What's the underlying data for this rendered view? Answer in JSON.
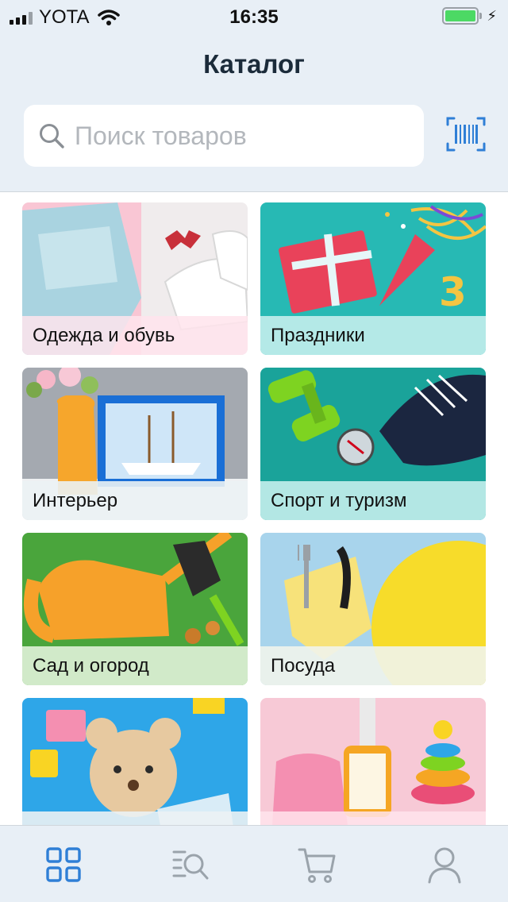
{
  "status_bar": {
    "carrier": "YOTA",
    "time": "16:35"
  },
  "header": {
    "title": "Каталог"
  },
  "search": {
    "placeholder": "Поиск товаров"
  },
  "categories": [
    {
      "label": "Одежда и обувь"
    },
    {
      "label": "Праздники"
    },
    {
      "label": "Интерьер"
    },
    {
      "label": "Спорт и туризм"
    },
    {
      "label": "Сад и огород"
    },
    {
      "label": "Посуда"
    },
    {
      "label": ""
    },
    {
      "label": ""
    }
  ],
  "icons": {
    "tab_catalog": "grid-icon",
    "tab_search": "list-search-icon",
    "tab_cart": "cart-icon",
    "tab_profile": "user-icon",
    "scanner": "barcode-scanner-icon"
  },
  "colors": {
    "accent": "#2f7fd6",
    "inactive": "#9aa3ab",
    "background": "#e8eff6"
  }
}
